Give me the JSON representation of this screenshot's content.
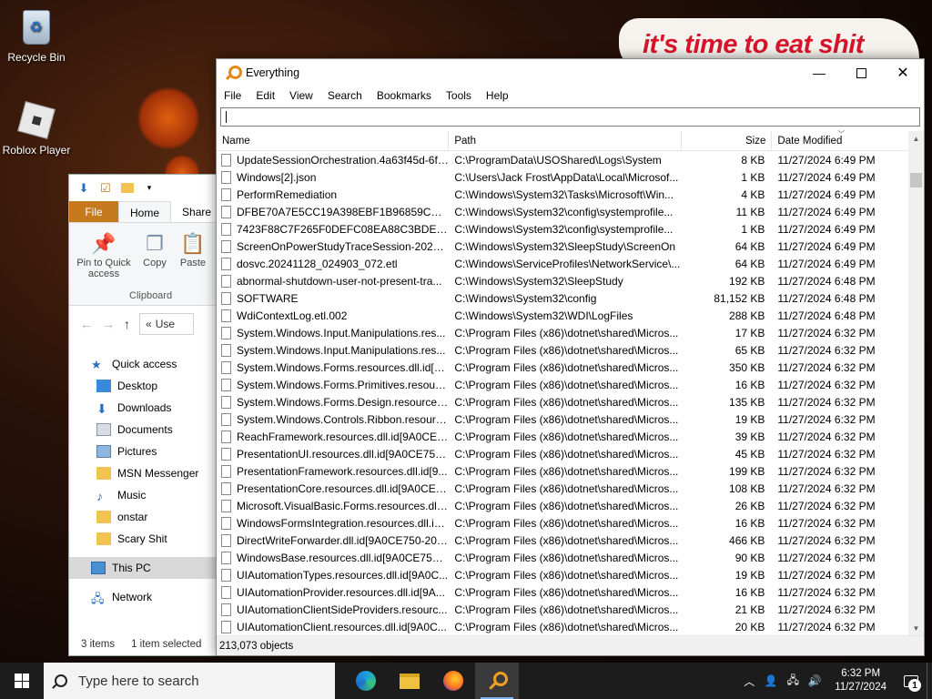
{
  "desktop": {
    "icons": [
      {
        "label": "Recycle Bin"
      },
      {
        "label": "Roblox Player"
      }
    ],
    "wallpaper_text": "it's time to eat shit"
  },
  "explorer": {
    "tabs": {
      "file": "File",
      "home": "Home",
      "share": "Share"
    },
    "ribbon": {
      "pin": "Pin to Quick access",
      "copy": "Copy",
      "paste": "Paste",
      "group": "Clipboard"
    },
    "address": "Use",
    "nav": {
      "quick_access": "Quick access",
      "items": [
        "Desktop",
        "Downloads",
        "Documents",
        "Pictures",
        "MSN Messenger",
        "Music",
        "onstar",
        "Scary Shit"
      ],
      "this_pc": "This PC",
      "network": "Network"
    },
    "status": {
      "items": "3 items",
      "selected": "1 item selected"
    }
  },
  "everything": {
    "title": "Everything",
    "menu": [
      "File",
      "Edit",
      "View",
      "Search",
      "Bookmarks",
      "Tools",
      "Help"
    ],
    "search": {
      "value": "",
      "placeholder": ""
    },
    "columns": {
      "name": "Name",
      "path": "Path",
      "size": "Size",
      "date": "Date Modified"
    },
    "rows": [
      [
        "UpdateSessionOrchestration.4a63f45d-6f1...",
        "C:\\ProgramData\\USOShared\\Logs\\System",
        "8 KB",
        "11/27/2024 6:49 PM"
      ],
      [
        "Windows[2].json",
        "C:\\Users\\Jack Frost\\AppData\\Local\\Microsof...",
        "1 KB",
        "11/27/2024 6:49 PM"
      ],
      [
        "PerformRemediation",
        "C:\\Windows\\System32\\Tasks\\Microsoft\\Win...",
        "4 KB",
        "11/27/2024 6:49 PM"
      ],
      [
        "DFBE70A7E5CC19A398EBF1B96859CE5D",
        "C:\\Windows\\System32\\config\\systemprofile...",
        "11 KB",
        "11/27/2024 6:49 PM"
      ],
      [
        "7423F88C7F265F0DEFC08EA88C3BDE45_A...",
        "C:\\Windows\\System32\\config\\systemprofile...",
        "1 KB",
        "11/27/2024 6:49 PM"
      ],
      [
        "ScreenOnPowerStudyTraceSession-2024-1...",
        "C:\\Windows\\System32\\SleepStudy\\ScreenOn",
        "64 KB",
        "11/27/2024 6:49 PM"
      ],
      [
        "dosvc.20241128_024903_072.etl",
        "C:\\Windows\\ServiceProfiles\\NetworkService\\...",
        "64 KB",
        "11/27/2024 6:49 PM"
      ],
      [
        "abnormal-shutdown-user-not-present-tra...",
        "C:\\Windows\\System32\\SleepStudy",
        "192 KB",
        "11/27/2024 6:48 PM"
      ],
      [
        "SOFTWARE",
        "C:\\Windows\\System32\\config",
        "81,152 KB",
        "11/27/2024 6:48 PM"
      ],
      [
        "WdiContextLog.etl.002",
        "C:\\Windows\\System32\\WDI\\LogFiles",
        "288 KB",
        "11/27/2024 6:48 PM"
      ],
      [
        "System.Windows.Input.Manipulations.res...",
        "C:\\Program Files (x86)\\dotnet\\shared\\Micros...",
        "17 KB",
        "11/27/2024 6:32 PM"
      ],
      [
        "System.Windows.Input.Manipulations.res...",
        "C:\\Program Files (x86)\\dotnet\\shared\\Micros...",
        "65 KB",
        "11/27/2024 6:32 PM"
      ],
      [
        "System.Windows.Forms.resources.dll.id[9...",
        "C:\\Program Files (x86)\\dotnet\\shared\\Micros...",
        "350 KB",
        "11/27/2024 6:32 PM"
      ],
      [
        "System.Windows.Forms.Primitives.resourc...",
        "C:\\Program Files (x86)\\dotnet\\shared\\Micros...",
        "16 KB",
        "11/27/2024 6:32 PM"
      ],
      [
        "System.Windows.Forms.Design.resources....",
        "C:\\Program Files (x86)\\dotnet\\shared\\Micros...",
        "135 KB",
        "11/27/2024 6:32 PM"
      ],
      [
        "System.Windows.Controls.Ribbon.resourc...",
        "C:\\Program Files (x86)\\dotnet\\shared\\Micros...",
        "19 KB",
        "11/27/2024 6:32 PM"
      ],
      [
        "ReachFramework.resources.dll.id[9A0CE75...",
        "C:\\Program Files (x86)\\dotnet\\shared\\Micros...",
        "39 KB",
        "11/27/2024 6:32 PM"
      ],
      [
        "PresentationUI.resources.dll.id[9A0CE750-...",
        "C:\\Program Files (x86)\\dotnet\\shared\\Micros...",
        "45 KB",
        "11/27/2024 6:32 PM"
      ],
      [
        "PresentationFramework.resources.dll.id[9...",
        "C:\\Program Files (x86)\\dotnet\\shared\\Micros...",
        "199 KB",
        "11/27/2024 6:32 PM"
      ],
      [
        "PresentationCore.resources.dll.id[9A0CE75...",
        "C:\\Program Files (x86)\\dotnet\\shared\\Micros...",
        "108 KB",
        "11/27/2024 6:32 PM"
      ],
      [
        "Microsoft.VisualBasic.Forms.resources.dll.i...",
        "C:\\Program Files (x86)\\dotnet\\shared\\Micros...",
        "26 KB",
        "11/27/2024 6:32 PM"
      ],
      [
        "WindowsFormsIntegration.resources.dll.id...",
        "C:\\Program Files (x86)\\dotnet\\shared\\Micros...",
        "16 KB",
        "11/27/2024 6:32 PM"
      ],
      [
        "DirectWriteForwarder.dll.id[9A0CE750-202...",
        "C:\\Program Files (x86)\\dotnet\\shared\\Micros...",
        "466 KB",
        "11/27/2024 6:32 PM"
      ],
      [
        "WindowsBase.resources.dll.id[9A0CE750-2...",
        "C:\\Program Files (x86)\\dotnet\\shared\\Micros...",
        "90 KB",
        "11/27/2024 6:32 PM"
      ],
      [
        "UIAutomationTypes.resources.dll.id[9A0C...",
        "C:\\Program Files (x86)\\dotnet\\shared\\Micros...",
        "19 KB",
        "11/27/2024 6:32 PM"
      ],
      [
        "UIAutomationProvider.resources.dll.id[9A...",
        "C:\\Program Files (x86)\\dotnet\\shared\\Micros...",
        "16 KB",
        "11/27/2024 6:32 PM"
      ],
      [
        "UIAutomationClientSideProviders.resourc...",
        "C:\\Program Files (x86)\\dotnet\\shared\\Micros...",
        "21 KB",
        "11/27/2024 6:32 PM"
      ],
      [
        "UIAutomationClient.resources.dll.id[9A0C...",
        "C:\\Program Files (x86)\\dotnet\\shared\\Micros...",
        "20 KB",
        "11/27/2024 6:32 PM"
      ]
    ],
    "status": "213,073 objects"
  },
  "taskbar": {
    "search_placeholder": "Type here to search",
    "apps": [
      "edge-icon",
      "file-explorer-icon",
      "firefox-icon",
      "everything-icon"
    ],
    "time": "6:32 PM",
    "date": "11/27/2024",
    "notification_count": "1"
  }
}
